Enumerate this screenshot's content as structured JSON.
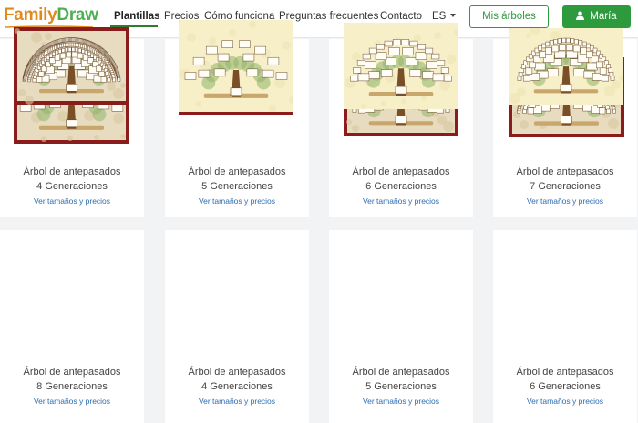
{
  "header": {
    "logo_part1": "Family",
    "logo_part2": "Draw",
    "nav": [
      "Plantillas",
      "Precios",
      "Cómo funciona",
      "Preguntas frecuentes",
      "Contacto"
    ],
    "language": "ES",
    "my_trees_button": "Mis árboles",
    "user_button": "María"
  },
  "colors": {
    "accent_green": "#2e9a3e",
    "logo_orange": "#e08a1c",
    "link_blue": "#2b6cb0"
  },
  "templates": [
    {
      "title": "Árbol de antepasados",
      "generations": "4 Generaciones",
      "link": "Ver tamaños y precios"
    },
    {
      "title": "Árbol de antepasados",
      "generations": "5 Generaciones",
      "link": "Ver tamaños y precios"
    },
    {
      "title": "Árbol de antepasados",
      "generations": "6 Generaciones",
      "link": "Ver tamaños y precios"
    },
    {
      "title": "Árbol de antepasados",
      "generations": "7 Generaciones",
      "link": "Ver tamaños y precios"
    },
    {
      "title": "Árbol de antepasados",
      "generations": "8 Generaciones",
      "link": "Ver tamaños y precios"
    },
    {
      "title": "Árbol de antepasados",
      "generations": "4 Generaciones",
      "link": "Ver tamaños y precios"
    },
    {
      "title": "Árbol de antepasados",
      "generations": "5 Generaciones",
      "link": "Ver tamaños y precios"
    },
    {
      "title": "Árbol de antepasados",
      "generations": "6 Generaciones",
      "link": "Ver tamaños y precios"
    }
  ]
}
